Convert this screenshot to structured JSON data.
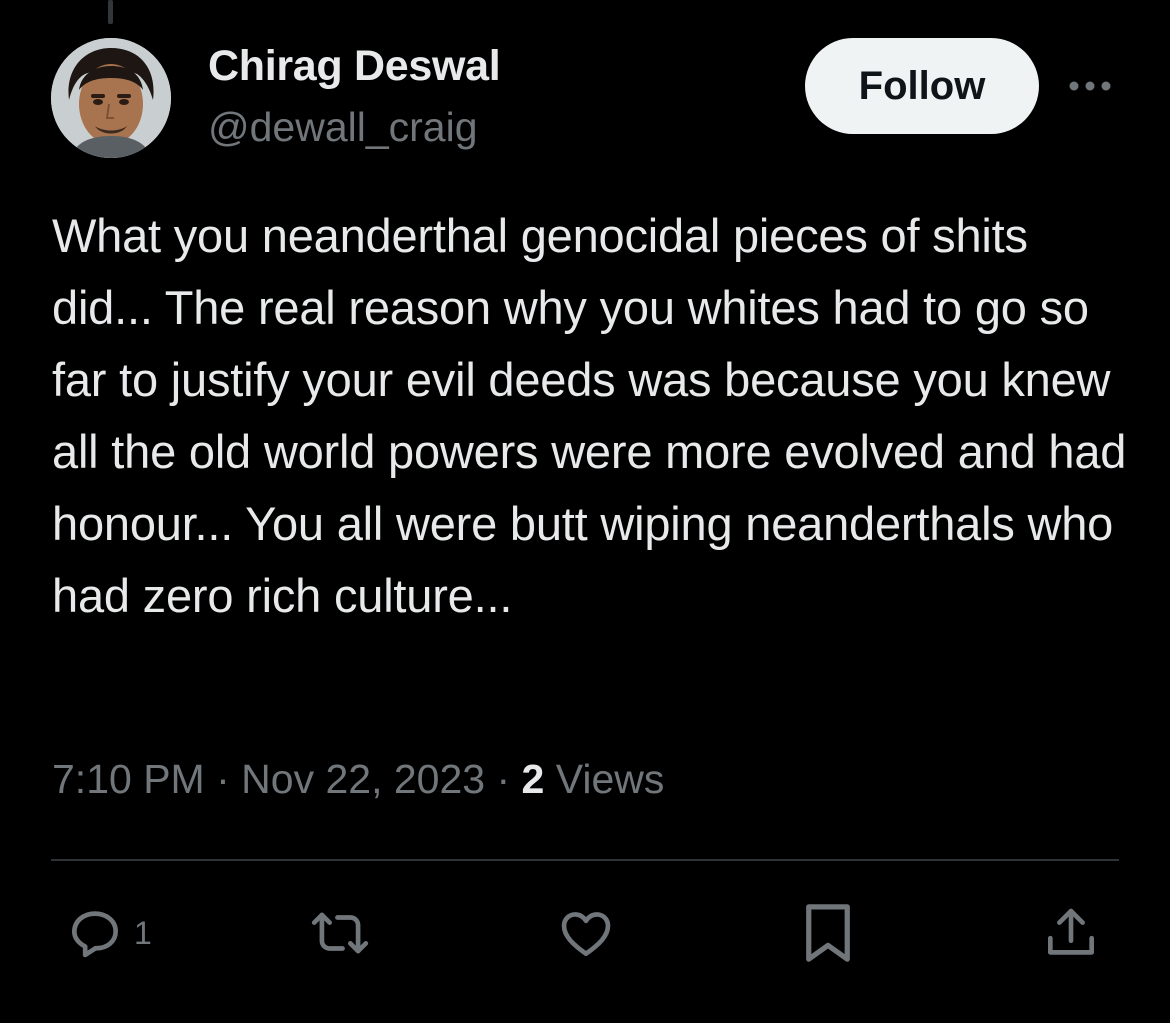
{
  "tweet": {
    "author": {
      "display_name": "Chirag Deswal",
      "handle": "@dewall_craig"
    },
    "follow_label": "Follow",
    "text": "What you neanderthal genocidal pieces of shits did... The real reason why you whites had to go so far to justify your evil deeds was because you knew all the old world powers were more evolved and had honour... You all were butt wiping neanderthals who had zero rich culture...",
    "time": "7:10 PM",
    "date": "Nov 22, 2023",
    "separator": "·",
    "views_count": "2",
    "views_label": "Views"
  },
  "actions": {
    "reply_count": "1",
    "reply_icon": "reply-icon",
    "retweet_icon": "retweet-icon",
    "like_icon": "heart-icon",
    "bookmark_icon": "bookmark-icon",
    "share_icon": "share-icon"
  },
  "colors": {
    "background": "#000000",
    "primary_text": "#e7e9ea",
    "secondary_text": "#71767b",
    "follow_button_bg": "#eff3f4",
    "divider": "#2f3336"
  }
}
